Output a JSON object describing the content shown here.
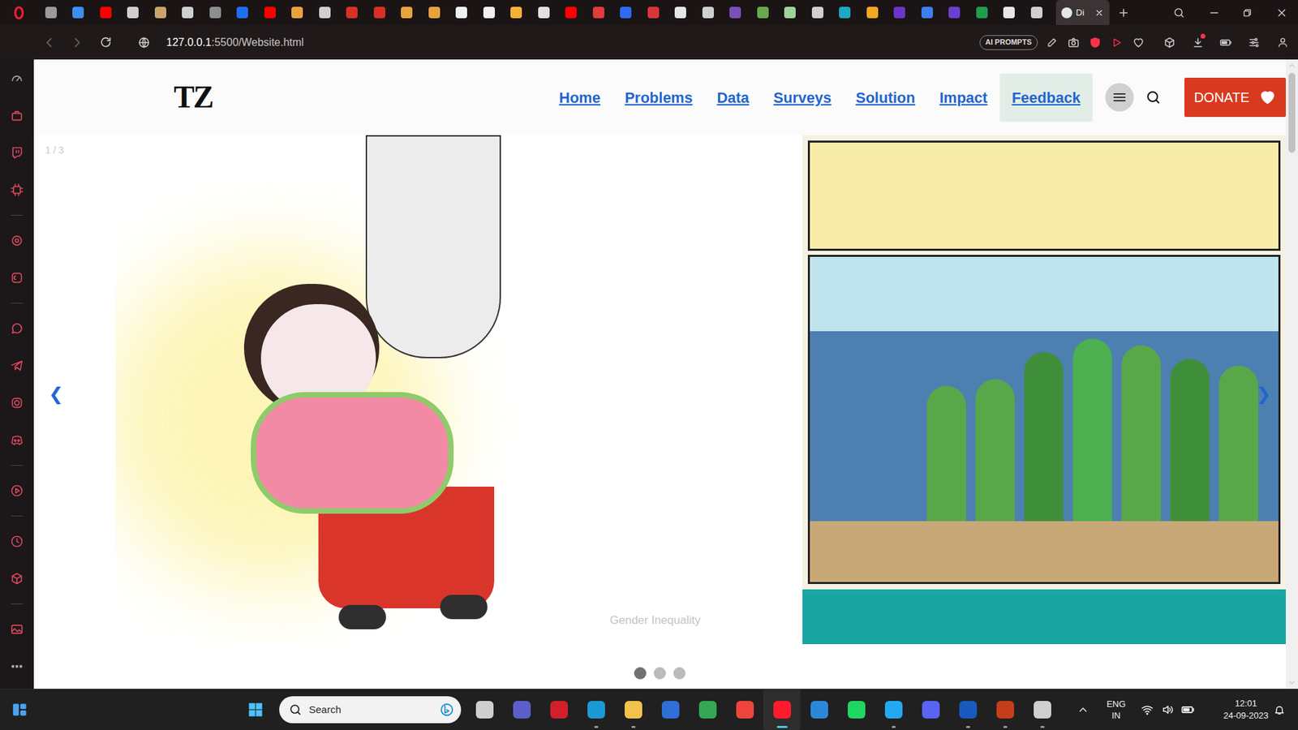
{
  "browser": {
    "tabs": [
      {
        "selected": false,
        "color": "#9a9a9a"
      },
      {
        "selected": false,
        "color": "#3d8ef0"
      },
      {
        "selected": false,
        "color": "#ff0000"
      },
      {
        "selected": false,
        "color": "#cfcfcf"
      },
      {
        "selected": false,
        "color": "#c9a36b"
      },
      {
        "selected": false,
        "color": "#cfcfcf"
      },
      {
        "selected": false,
        "color": "#8d8d8d"
      },
      {
        "selected": false,
        "color": "#1e6ff0"
      },
      {
        "selected": false,
        "color": "#ff0000"
      },
      {
        "selected": false,
        "color": "#e8a33c"
      },
      {
        "selected": false,
        "color": "#cfcfcf"
      },
      {
        "selected": false,
        "color": "#d93025"
      },
      {
        "selected": false,
        "color": "#d93025"
      },
      {
        "selected": false,
        "color": "#e8a33c"
      },
      {
        "selected": false,
        "color": "#e8a33c"
      },
      {
        "selected": false,
        "color": "#f0f0f0"
      },
      {
        "selected": false,
        "color": "#f0f0f0"
      },
      {
        "selected": false,
        "color": "#f2b233"
      },
      {
        "selected": false,
        "color": "#e0e0e0"
      },
      {
        "selected": false,
        "color": "#ff0000"
      },
      {
        "selected": false,
        "color": "#e23b3b"
      },
      {
        "selected": false,
        "color": "#2d6cf0"
      },
      {
        "selected": false,
        "color": "#d8353b"
      },
      {
        "selected": false,
        "color": "#e6e6e6"
      },
      {
        "selected": false,
        "color": "#cfcfcf"
      },
      {
        "selected": false,
        "color": "#7b4fb8"
      },
      {
        "selected": false,
        "color": "#6aa84f"
      },
      {
        "selected": false,
        "color": "#9fd39a"
      },
      {
        "selected": false,
        "color": "#cfcfcf"
      },
      {
        "selected": false,
        "color": "#1ea7c2"
      },
      {
        "selected": false,
        "color": "#f5a623"
      },
      {
        "selected": false,
        "color": "#6d34c9"
      },
      {
        "selected": false,
        "color": "#3b7ff2"
      },
      {
        "selected": false,
        "color": "#6b3fd1"
      },
      {
        "selected": false,
        "color": "#1f9d4a"
      },
      {
        "selected": false,
        "color": "#e6e6e6"
      },
      {
        "selected": false,
        "color": "#cfcfcf"
      },
      {
        "label": "Di",
        "selected": true,
        "color": "#e6e6e6"
      }
    ],
    "address": {
      "host": "127.0.0.1",
      "path": ":5500/Website.html"
    },
    "toolbar": {
      "ai_prompts": "AI PROMPTS"
    },
    "downloads_badge": true
  },
  "site": {
    "logo": "TZ",
    "nav": [
      {
        "label": "Home",
        "highlighted": false
      },
      {
        "label": "Problems",
        "highlighted": false
      },
      {
        "label": "Data",
        "highlighted": false
      },
      {
        "label": "Surveys",
        "highlighted": false
      },
      {
        "label": "Solution",
        "highlighted": false
      },
      {
        "label": "Impact",
        "highlighted": false
      },
      {
        "label": "Feedback",
        "highlighted": true
      }
    ],
    "donate": "DONATE",
    "slideshow": {
      "counter": "1 / 3",
      "caption": "Gender Inequality",
      "prev": "❮",
      "next": "❯",
      "dots": [
        {
          "selected": true
        },
        {
          "selected": false
        },
        {
          "selected": false
        }
      ]
    }
  },
  "taskbar": {
    "search_placeholder": "Search",
    "apps": [
      {
        "color": "#cfcfcf",
        "running": false,
        "active": false
      },
      {
        "color": "#5b5fc7",
        "running": false,
        "active": false
      },
      {
        "color": "#d21f2c",
        "running": false,
        "active": false
      },
      {
        "color": "#1c9ad6",
        "running": true,
        "active": false
      },
      {
        "color": "#f2c14e",
        "running": true,
        "active": false
      },
      {
        "color": "#2f6fd6",
        "running": false,
        "active": false
      },
      {
        "color": "#34a853",
        "running": false,
        "active": false
      },
      {
        "color": "#ef443b",
        "running": false,
        "active": false
      },
      {
        "color": "#ff1b2d",
        "running": true,
        "active": true
      },
      {
        "color": "#2b88d8",
        "running": false,
        "active": false
      },
      {
        "color": "#1ed760",
        "running": false,
        "active": false
      },
      {
        "color": "#23a9f2",
        "running": true,
        "active": false
      },
      {
        "color": "#5865f2",
        "running": false,
        "active": false
      },
      {
        "color": "#185abd",
        "running": true,
        "active": false
      },
      {
        "color": "#c43e1c",
        "running": true,
        "active": false
      },
      {
        "color": "#d0d0d0",
        "running": true,
        "active": false
      }
    ],
    "language": "ENG",
    "region": "IN",
    "time": "12:01",
    "date": "24-09-2023"
  }
}
